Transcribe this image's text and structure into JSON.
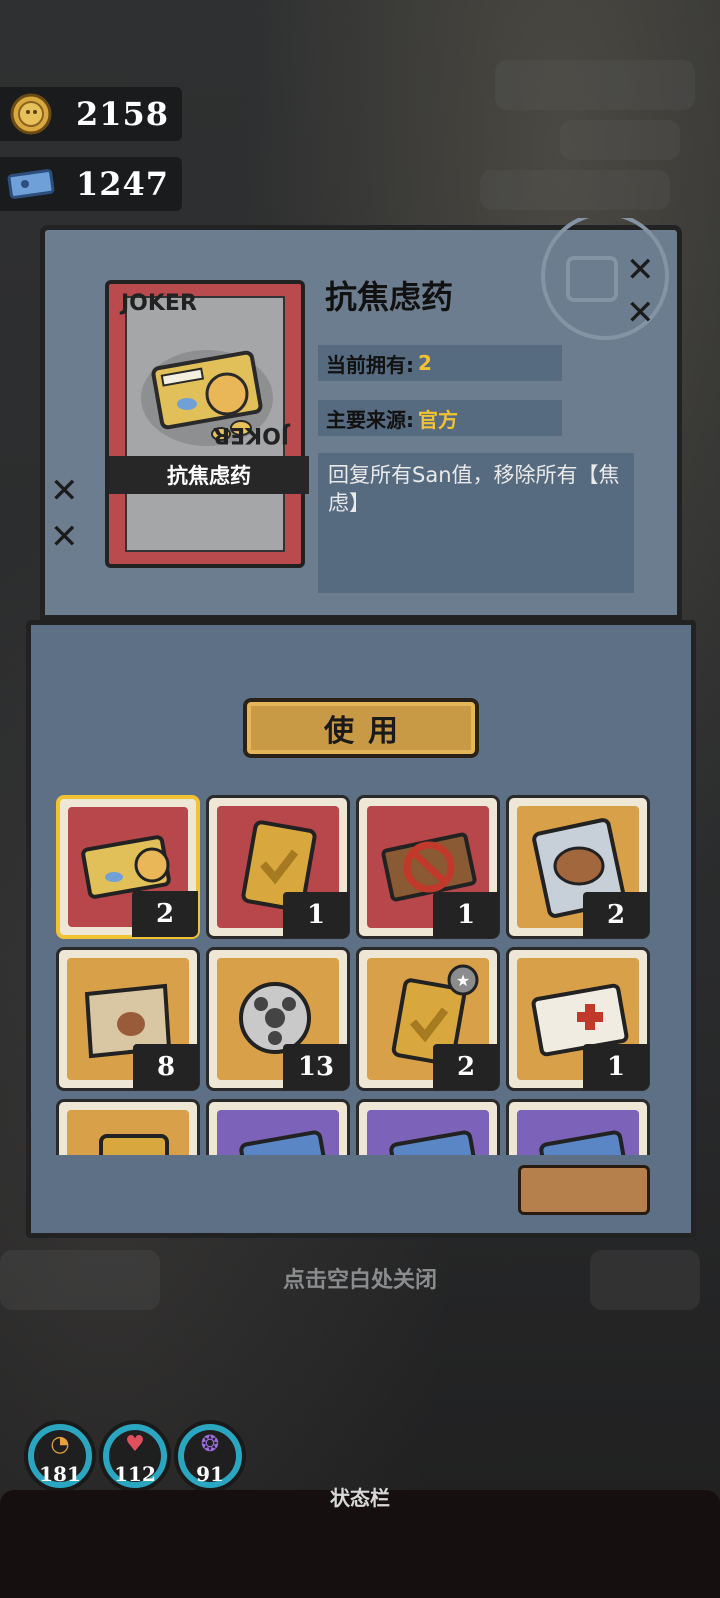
{
  "currency": {
    "coins": "2158",
    "tickets": "1247"
  },
  "detail": {
    "title": "抗焦虑药",
    "card_label": "抗焦虑药",
    "joker_text": "JOKER",
    "owned_label": "当前拥有:",
    "owned_value": "2",
    "source_label": "主要来源:",
    "source_value": "官方",
    "description": "回复所有San值，移除所有【焦虑】"
  },
  "use_button": "使用",
  "inventory": [
    {
      "name": "anxiety-pills",
      "count": "2",
      "bg": "#b8474b",
      "selected": true
    },
    {
      "name": "gold-shield-badge",
      "count": "1",
      "bg": "#b8474b"
    },
    {
      "name": "banned-ticket",
      "count": "1",
      "bg": "#b8474b"
    },
    {
      "name": "capybara-pack",
      "count": "2",
      "bg": "#d9a04a"
    },
    {
      "name": "treasure-map",
      "count": "8",
      "bg": "#d9a04a"
    },
    {
      "name": "film-reel",
      "count": "13",
      "bg": "#d9a04a"
    },
    {
      "name": "star-shield-badge",
      "count": "2",
      "bg": "#d9a04a"
    },
    {
      "name": "medical-card",
      "count": "1",
      "bg": "#d9a04a"
    },
    {
      "name": "gold-card",
      "count": "",
      "bg": "#d9a04a"
    },
    {
      "name": "blue-card",
      "count": "",
      "bg": "#7c62b8"
    },
    {
      "name": "blue-card",
      "count": "",
      "bg": "#7c62b8"
    },
    {
      "name": "blue-card",
      "count": "",
      "bg": "#7c62b8"
    }
  ],
  "close_hint": "点击空白处关闭",
  "stats": {
    "hunger": "181",
    "health": "112",
    "sanity": "91"
  },
  "statusbar_label": "状态栏"
}
